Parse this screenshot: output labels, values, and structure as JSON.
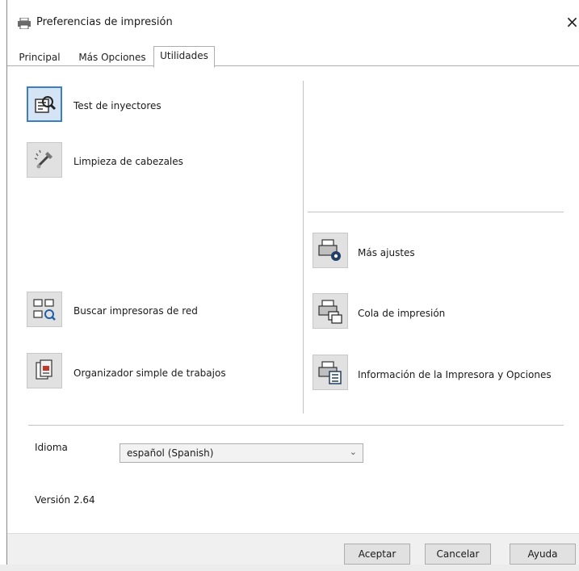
{
  "window": {
    "title": "Preferencias de impresión",
    "close_glyph": "×"
  },
  "tabs": [
    {
      "label": "Principal"
    },
    {
      "label": "Más Opciones"
    },
    {
      "label": "Utilidades",
      "active": true
    }
  ],
  "utilities": {
    "nozzle_check": "Test de inyectores",
    "head_cleaning": "Limpieza de cabezales",
    "find_network_printers": "Buscar impresoras de red",
    "job_arranger": "Organizador simple de trabajos",
    "more_settings": "Más ajustes",
    "print_queue": "Cola de impresión",
    "printer_info": "Información de la Impresora y Opciones"
  },
  "language": {
    "label": "Idioma",
    "selected": "español (Spanish)"
  },
  "version": "Versión 2.64",
  "footer": {
    "ok": "Aceptar",
    "cancel": "Cancelar",
    "help": "Ayuda"
  },
  "icons": {
    "title": "printer-icon",
    "nozzle_check": "nozzle-check-icon",
    "head_cleaning": "head-cleaning-icon",
    "find_network_printers": "network-printers-icon",
    "job_arranger": "job-arranger-icon",
    "more_settings": "printer-settings-icon",
    "print_queue": "print-queue-icon",
    "printer_info": "printer-info-icon"
  },
  "colors": {
    "focus_border": "#3c7fc1",
    "button_face": "#e1e1e1",
    "footer_bg": "#f0f0f0"
  }
}
